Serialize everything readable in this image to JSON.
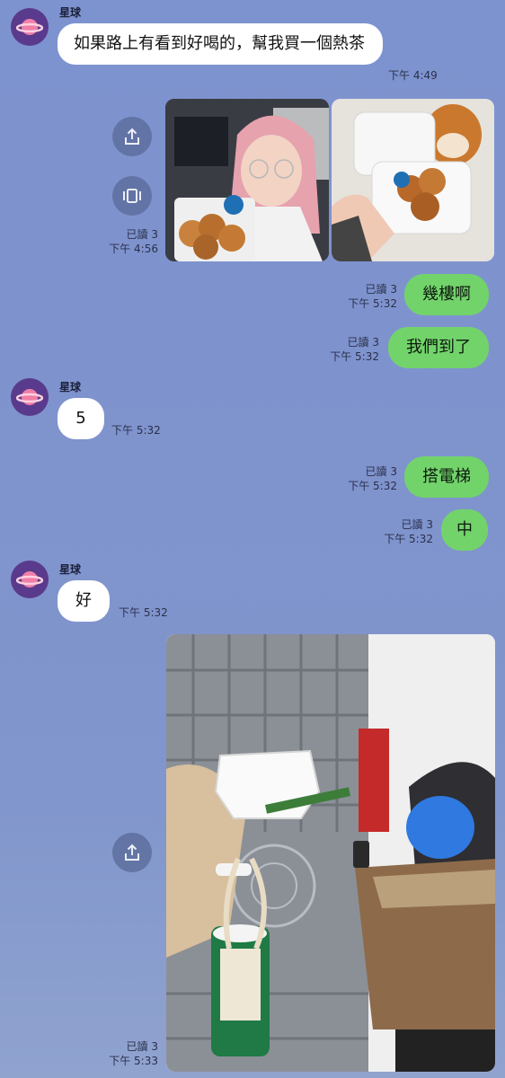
{
  "messages": {
    "m1": {
      "sender": "星球",
      "text": "如果路上有看到好喝的，幫我買一個熱茶",
      "time": "下午 4:49"
    },
    "m2": {
      "read": "已讀 3",
      "time": "下午 4:56"
    },
    "m3": {
      "read": "已讀 3",
      "time": "下午 5:32",
      "text": "幾樓啊"
    },
    "m4": {
      "read": "已讀 3",
      "time": "下午 5:32",
      "text": "我們到了"
    },
    "m5": {
      "sender": "星球",
      "text": "5",
      "time": "下午 5:32"
    },
    "m6": {
      "read": "已讀 3",
      "time": "下午 5:32",
      "text": "搭電梯"
    },
    "m7": {
      "read": "已讀 3",
      "time": "下午 5:32",
      "text": "中"
    },
    "m8": {
      "sender": "星球",
      "text": "好",
      "time": "下午 5:32"
    },
    "m9": {
      "read": "已讀 3",
      "time": "下午 5:33"
    }
  },
  "colors": {
    "background": "#7f93cd",
    "outgoing_bubble": "#72d36b",
    "incoming_bubble": "#ffffff",
    "avatar": "#5a3a8c"
  },
  "icons": {
    "avatar": "planet-icon",
    "share": "share-icon",
    "album": "album-icon"
  }
}
